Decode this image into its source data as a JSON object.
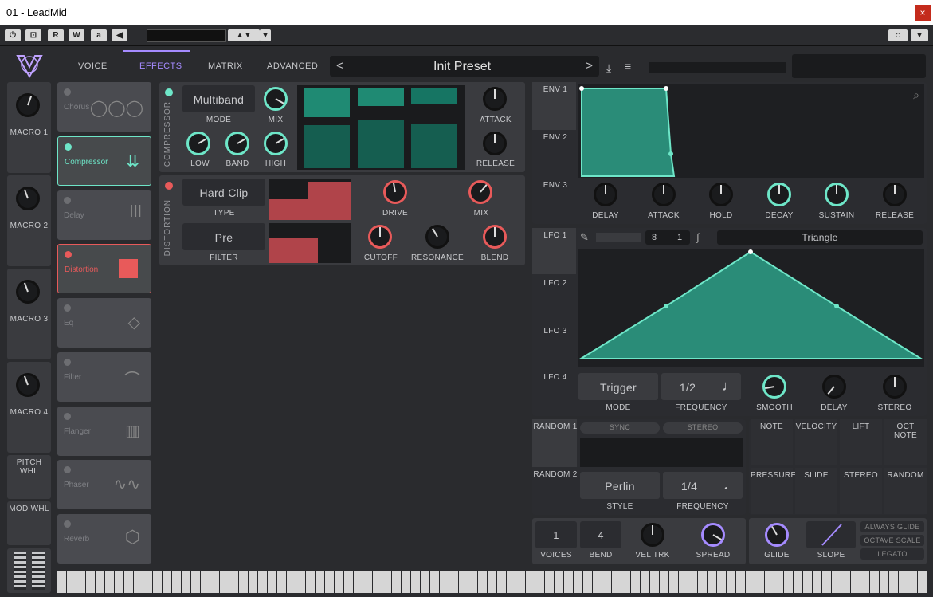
{
  "window": {
    "title": "01 - LeadMid",
    "close": "×"
  },
  "host": {
    "buttons": [
      "R",
      "W"
    ],
    "preset_field": ""
  },
  "nav": {
    "tabs": [
      "VOICE",
      "EFFECTS",
      "MATRIX",
      "ADVANCED"
    ],
    "active": "EFFECTS",
    "preset": "Init Preset",
    "prev": "<",
    "next": ">"
  },
  "macros": [
    "MACRO 1",
    "MACRO 2",
    "MACRO 3",
    "MACRO 4"
  ],
  "wheels": {
    "pitch": "PITCH WHL",
    "mod": "MOD WHL"
  },
  "effects": [
    {
      "name": "Chorus",
      "on": false
    },
    {
      "name": "Compressor",
      "on": true
    },
    {
      "name": "Delay",
      "on": false
    },
    {
      "name": "Distortion",
      "on": true
    },
    {
      "name": "Eq",
      "on": false
    },
    {
      "name": "Filter",
      "on": false
    },
    {
      "name": "Flanger",
      "on": false
    },
    {
      "name": "Phaser",
      "on": false
    },
    {
      "name": "Reverb",
      "on": false
    }
  ],
  "compressor": {
    "title": "COMPRESSOR",
    "mode_value": "Multiband",
    "mode": "MODE",
    "mix": "MIX",
    "low": "LOW",
    "band": "BAND",
    "high": "HIGH",
    "attack": "ATTACK",
    "release": "RELEASE"
  },
  "distortion": {
    "title": "DISTORTION",
    "type_value": "Hard Clip",
    "type": "TYPE",
    "filter_value": "Pre",
    "filter": "FILTER",
    "drive": "DRIVE",
    "mix": "MIX",
    "cutoff": "CUTOFF",
    "resonance": "RESONANCE",
    "blend": "BLEND"
  },
  "env": {
    "tabs": [
      "ENV 1",
      "ENV 2",
      "ENV 3"
    ],
    "knobs": [
      "DELAY",
      "ATTACK",
      "HOLD",
      "DECAY",
      "SUSTAIN",
      "RELEASE"
    ]
  },
  "lfo": {
    "tabs": [
      "LFO 1",
      "LFO 2",
      "LFO 3",
      "LFO 4"
    ],
    "sync_a": "8",
    "sync_b": "1",
    "shape": "Triangle",
    "mode_value": "Trigger",
    "mode": "MODE",
    "freq_value": "1/2",
    "frequency": "FREQUENCY",
    "smooth": "SMOOTH",
    "delay": "DELAY",
    "stereo": "STEREO"
  },
  "random": {
    "tabs": [
      "RANDOM 1",
      "RANDOM 2"
    ],
    "sync": "SYNC",
    "stereo": "STEREO",
    "style_value": "Perlin",
    "style": "STYLE",
    "freq_value": "1/4",
    "frequency": "FREQUENCY"
  },
  "mod_sources": [
    "NOTE",
    "VELOCITY",
    "LIFT",
    "OCT NOTE",
    "PRESSURE",
    "SLIDE",
    "STEREO",
    "RANDOM"
  ],
  "voice": {
    "voices_value": "1",
    "voices": "VOICES",
    "bend_value": "4",
    "bend": "BEND",
    "veltrk": "VEL TRK",
    "spread": "SPREAD",
    "glide": "GLIDE",
    "slope": "SLOPE",
    "always_glide": "ALWAYS GLIDE",
    "octave_scale": "OCTAVE SCALE",
    "legato": "LEGATO"
  },
  "colors": {
    "accent": "#6ee6c8",
    "red": "#e85a5a",
    "purple": "#a58bff"
  }
}
